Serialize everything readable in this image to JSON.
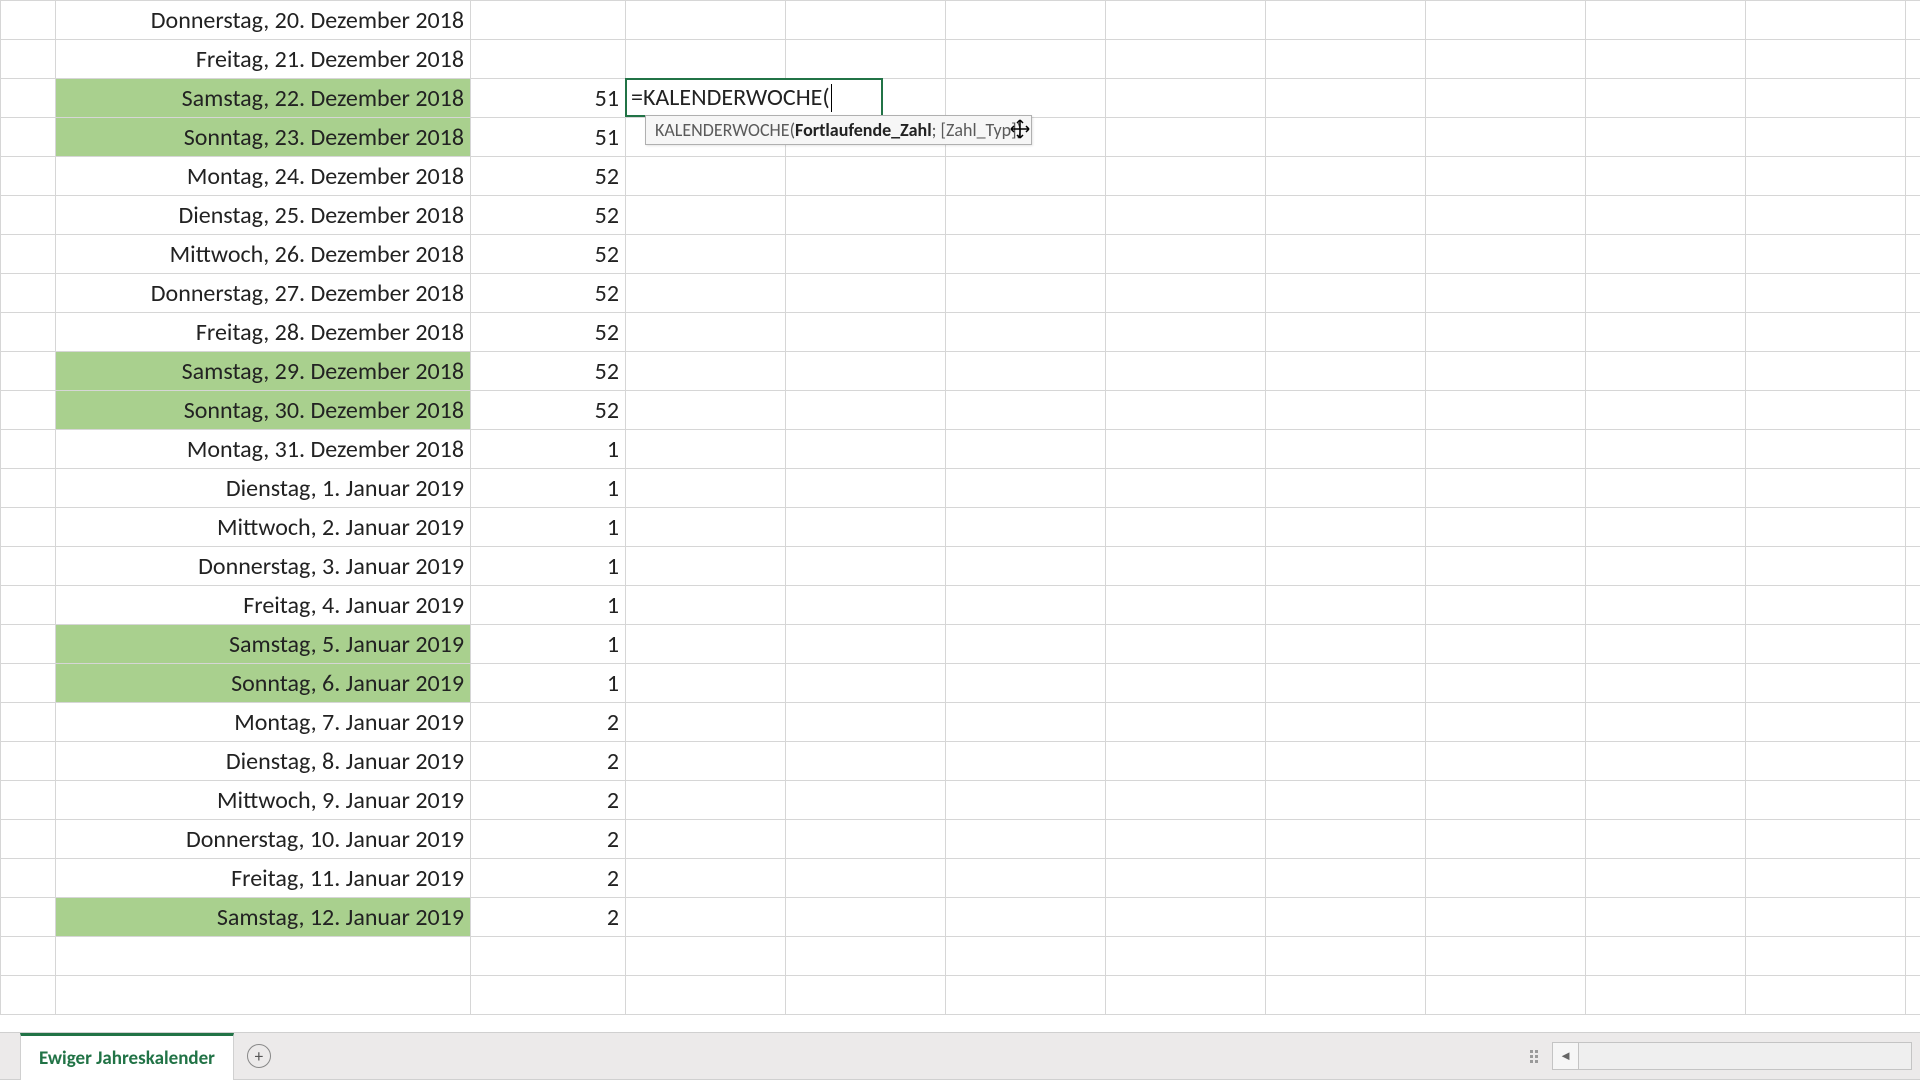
{
  "formula_input": "=KALENDERWOCHE(",
  "tooltip": {
    "fn_name": "KALENDERWOCHE",
    "arg_active": "Fortlaufende_Zahl",
    "separator": "; ",
    "arg_optional": "[Zahl_Typ]"
  },
  "sheet_tab": "Ewiger Jahreskalender",
  "rows": [
    {
      "date": "Donnerstag, 20. Dezember 2018",
      "week": "",
      "weekend": false,
      "editing": false
    },
    {
      "date": "Freitag, 21. Dezember 2018",
      "week": "",
      "weekend": false,
      "editing": false
    },
    {
      "date": "Samstag, 22. Dezember 2018",
      "week": "51",
      "weekend": true,
      "editing": true
    },
    {
      "date": "Sonntag, 23. Dezember 2018",
      "week": "51",
      "weekend": true,
      "editing": false
    },
    {
      "date": "Montag, 24. Dezember 2018",
      "week": "52",
      "weekend": false,
      "editing": false
    },
    {
      "date": "Dienstag, 25. Dezember 2018",
      "week": "52",
      "weekend": false,
      "editing": false
    },
    {
      "date": "Mittwoch, 26. Dezember 2018",
      "week": "52",
      "weekend": false,
      "editing": false
    },
    {
      "date": "Donnerstag, 27. Dezember 2018",
      "week": "52",
      "weekend": false,
      "editing": false
    },
    {
      "date": "Freitag, 28. Dezember 2018",
      "week": "52",
      "weekend": false,
      "editing": false
    },
    {
      "date": "Samstag, 29. Dezember 2018",
      "week": "52",
      "weekend": true,
      "editing": false
    },
    {
      "date": "Sonntag, 30. Dezember 2018",
      "week": "52",
      "weekend": true,
      "editing": false
    },
    {
      "date": "Montag, 31. Dezember 2018",
      "week": "1",
      "weekend": false,
      "editing": false
    },
    {
      "date": "Dienstag, 1. Januar 2019",
      "week": "1",
      "weekend": false,
      "editing": false
    },
    {
      "date": "Mittwoch, 2. Januar 2019",
      "week": "1",
      "weekend": false,
      "editing": false
    },
    {
      "date": "Donnerstag, 3. Januar 2019",
      "week": "1",
      "weekend": false,
      "editing": false
    },
    {
      "date": "Freitag, 4. Januar 2019",
      "week": "1",
      "weekend": false,
      "editing": false
    },
    {
      "date": "Samstag, 5. Januar 2019",
      "week": "1",
      "weekend": true,
      "editing": false
    },
    {
      "date": "Sonntag, 6. Januar 2019",
      "week": "1",
      "weekend": true,
      "editing": false
    },
    {
      "date": "Montag, 7. Januar 2019",
      "week": "2",
      "weekend": false,
      "editing": false
    },
    {
      "date": "Dienstag, 8. Januar 2019",
      "week": "2",
      "weekend": false,
      "editing": false
    },
    {
      "date": "Mittwoch, 9. Januar 2019",
      "week": "2",
      "weekend": false,
      "editing": false
    },
    {
      "date": "Donnerstag, 10. Januar 2019",
      "week": "2",
      "weekend": false,
      "editing": false
    },
    {
      "date": "Freitag, 11. Januar 2019",
      "week": "2",
      "weekend": false,
      "editing": false
    },
    {
      "date": "Samstag, 12. Januar 2019",
      "week": "2",
      "weekend": true,
      "editing": false
    },
    {
      "date": "",
      "week": "",
      "weekend": false,
      "editing": false
    },
    {
      "date": "",
      "week": "",
      "weekend": false,
      "editing": false
    }
  ],
  "extra_cols": 9
}
